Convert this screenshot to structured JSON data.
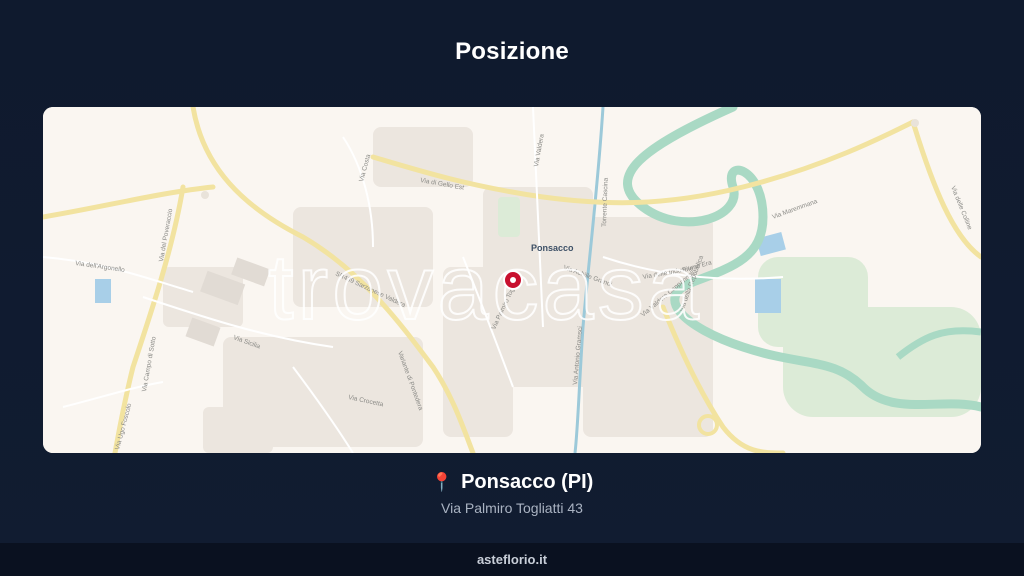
{
  "page": {
    "title": "Posizione"
  },
  "map": {
    "town_label": "Ponsacco",
    "watermark": "trovacasa",
    "marker_icon": "map-marker-icon",
    "marker_color": "#c8102e",
    "streets": [
      "Via di Gello Est",
      "Via Valdera",
      "Via Costa",
      "Via dell'Argonello",
      "Via del Poveraccio",
      "Via Sicilia",
      "Via Maremmana",
      "Via delle Colline",
      "Via Ugo Foscolo",
      "Via Campo di Sotto",
      "Via Palmiro Togliatti",
      "Via Antonio Gramsci",
      "Via Valdera Cappannoli",
      "Via della Repubblica",
      "Via delle Industrie",
      "Via Achille Grandi",
      "Via Crocetta",
      "Torrente Cascina",
      "Fiume Era",
      "Variante di Pontedera",
      "SR439 Sarzanese Valdera"
    ]
  },
  "location": {
    "pin_icon": "pin-icon",
    "name": "Ponsacco (PI)",
    "address": "Via Palmiro Togliatti 43"
  },
  "footer": {
    "site": "asteflorio.it"
  },
  "colors": {
    "background": "#0f1a2e",
    "map_land": "#faf6f1",
    "river": "#a9d9c4",
    "water": "#a8cfe8",
    "road_major": "#f5e9a8",
    "pin": "#e8345a"
  }
}
